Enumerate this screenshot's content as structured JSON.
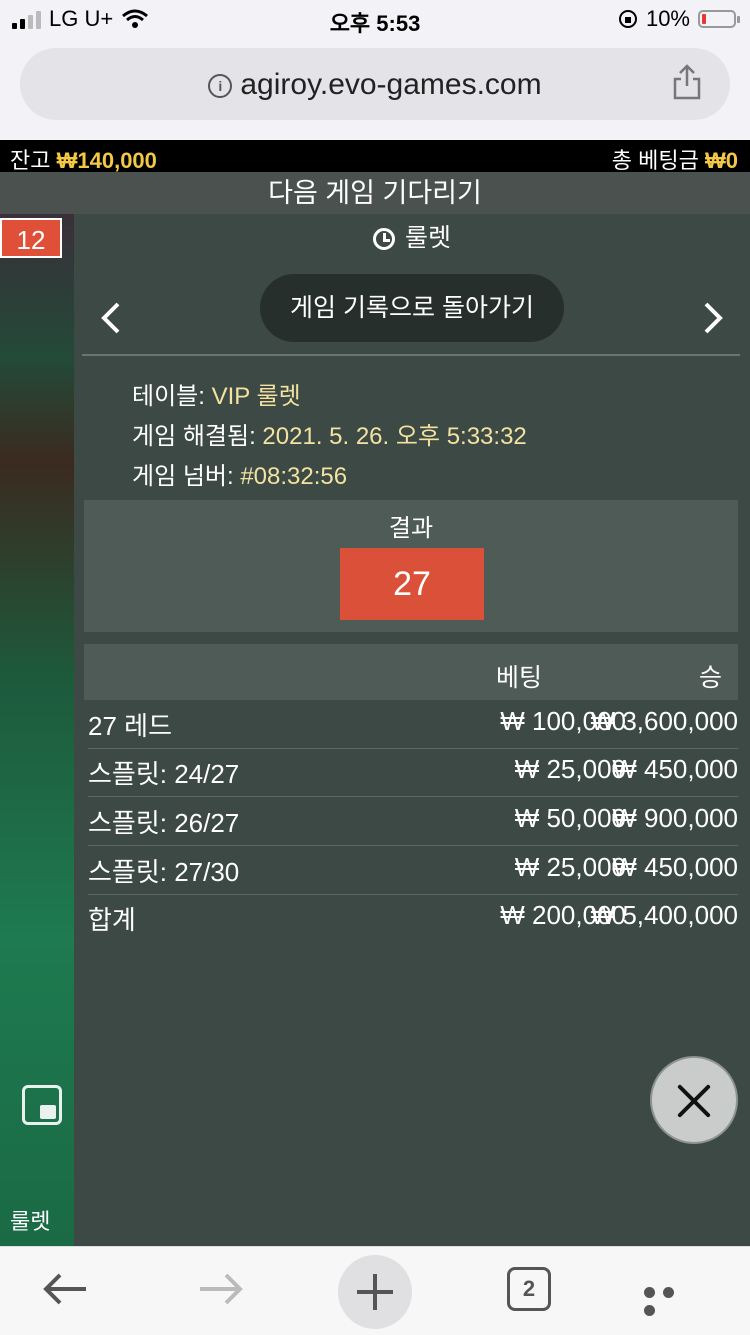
{
  "status_bar": {
    "carrier": "LG U+",
    "time": "오후 5:53",
    "battery": "10%"
  },
  "browser": {
    "url": "agiroy.evo-games.com"
  },
  "game": {
    "balance_label": "잔고",
    "balance_value": "₩140,000",
    "total_bet_label": "총 베팅금",
    "total_bet_value": "₩0",
    "waiting_text": "다음 게임 기다리기",
    "last_number": "12",
    "table_strip_name": "룰렛"
  },
  "history_panel": {
    "title": "룰렛",
    "back_button": "게임 기록으로 돌아가기",
    "meta": [
      {
        "label": "테이블:",
        "value": "VIP 룰렛"
      },
      {
        "label": "게임 해결됨:",
        "value": "2021. 5. 26. 오후 5:33:32"
      },
      {
        "label": "게임 넘버:",
        "value": "#08:32:56"
      }
    ],
    "result_label": "결과",
    "result_value": "27",
    "table_headers": {
      "bet": "베팅",
      "win": "승"
    },
    "rows": [
      {
        "label": "27 레드",
        "bet": "₩ 100,000",
        "win": "₩ 3,600,000"
      },
      {
        "label": "스플릿: 24/27",
        "bet": "₩ 25,000",
        "win": "₩ 450,000"
      },
      {
        "label": "스플릿: 26/27",
        "bet": "₩ 50,000",
        "win": "₩ 900,000"
      },
      {
        "label": "스플릿: 27/30",
        "bet": "₩ 25,000",
        "win": "₩ 450,000"
      },
      {
        "label": "합계",
        "bet": "₩ 200,000",
        "win": "₩ 5,400,000"
      }
    ]
  },
  "toolbar": {
    "tabs_count": "2"
  }
}
